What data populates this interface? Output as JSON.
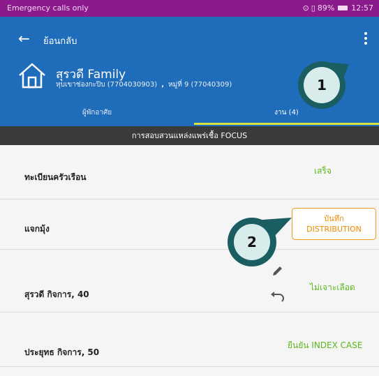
{
  "status_bar": {
    "left_text": "Emergency calls only",
    "battery": "89%",
    "time": "12:57"
  },
  "app_bar": {
    "back_label": "ย้อนกลับ",
    "menu_icon": "kebab-menu-icon"
  },
  "household": {
    "name": "สุรวดี Family",
    "location": "หุบเขาช่องกะปิบ (7704030903)",
    "separator": ",",
    "village": "หมู่ที่ 9 (77040309)",
    "icon": "house-icon"
  },
  "tabs": [
    {
      "label": "ผู้พักอาศัย"
    },
    {
      "label": "งาน (4)"
    }
  ],
  "section_title": "การสอบสวนแหล่งแพร่เชื้อ FOCUS",
  "tasks": [
    {
      "label": "ทะเบียนครัวเรือน",
      "status": "เสร็จ"
    },
    {
      "label": "แจกมุ้ง",
      "button_line1": "บันทึก",
      "button_line2": "DISTRIBUTION"
    },
    {
      "label": "สุรวดี  กิจการ, 40",
      "status": "ไม่เจาะเลือด"
    },
    {
      "label": "ประยุทธ  กิจการ, 50",
      "status": "ยืนยัน INDEX CASE"
    }
  ],
  "annotations": {
    "badge1": "1",
    "badge2": "2"
  },
  "colors": {
    "status_bar": "#8b1a8c",
    "app_bar": "#1f6cba",
    "tab_indicator": "#d9e23b",
    "section_bar": "#3a3a3a",
    "success_green": "#5cb820",
    "action_orange": "#f08a00",
    "badge_ring": "#1b5e62"
  }
}
